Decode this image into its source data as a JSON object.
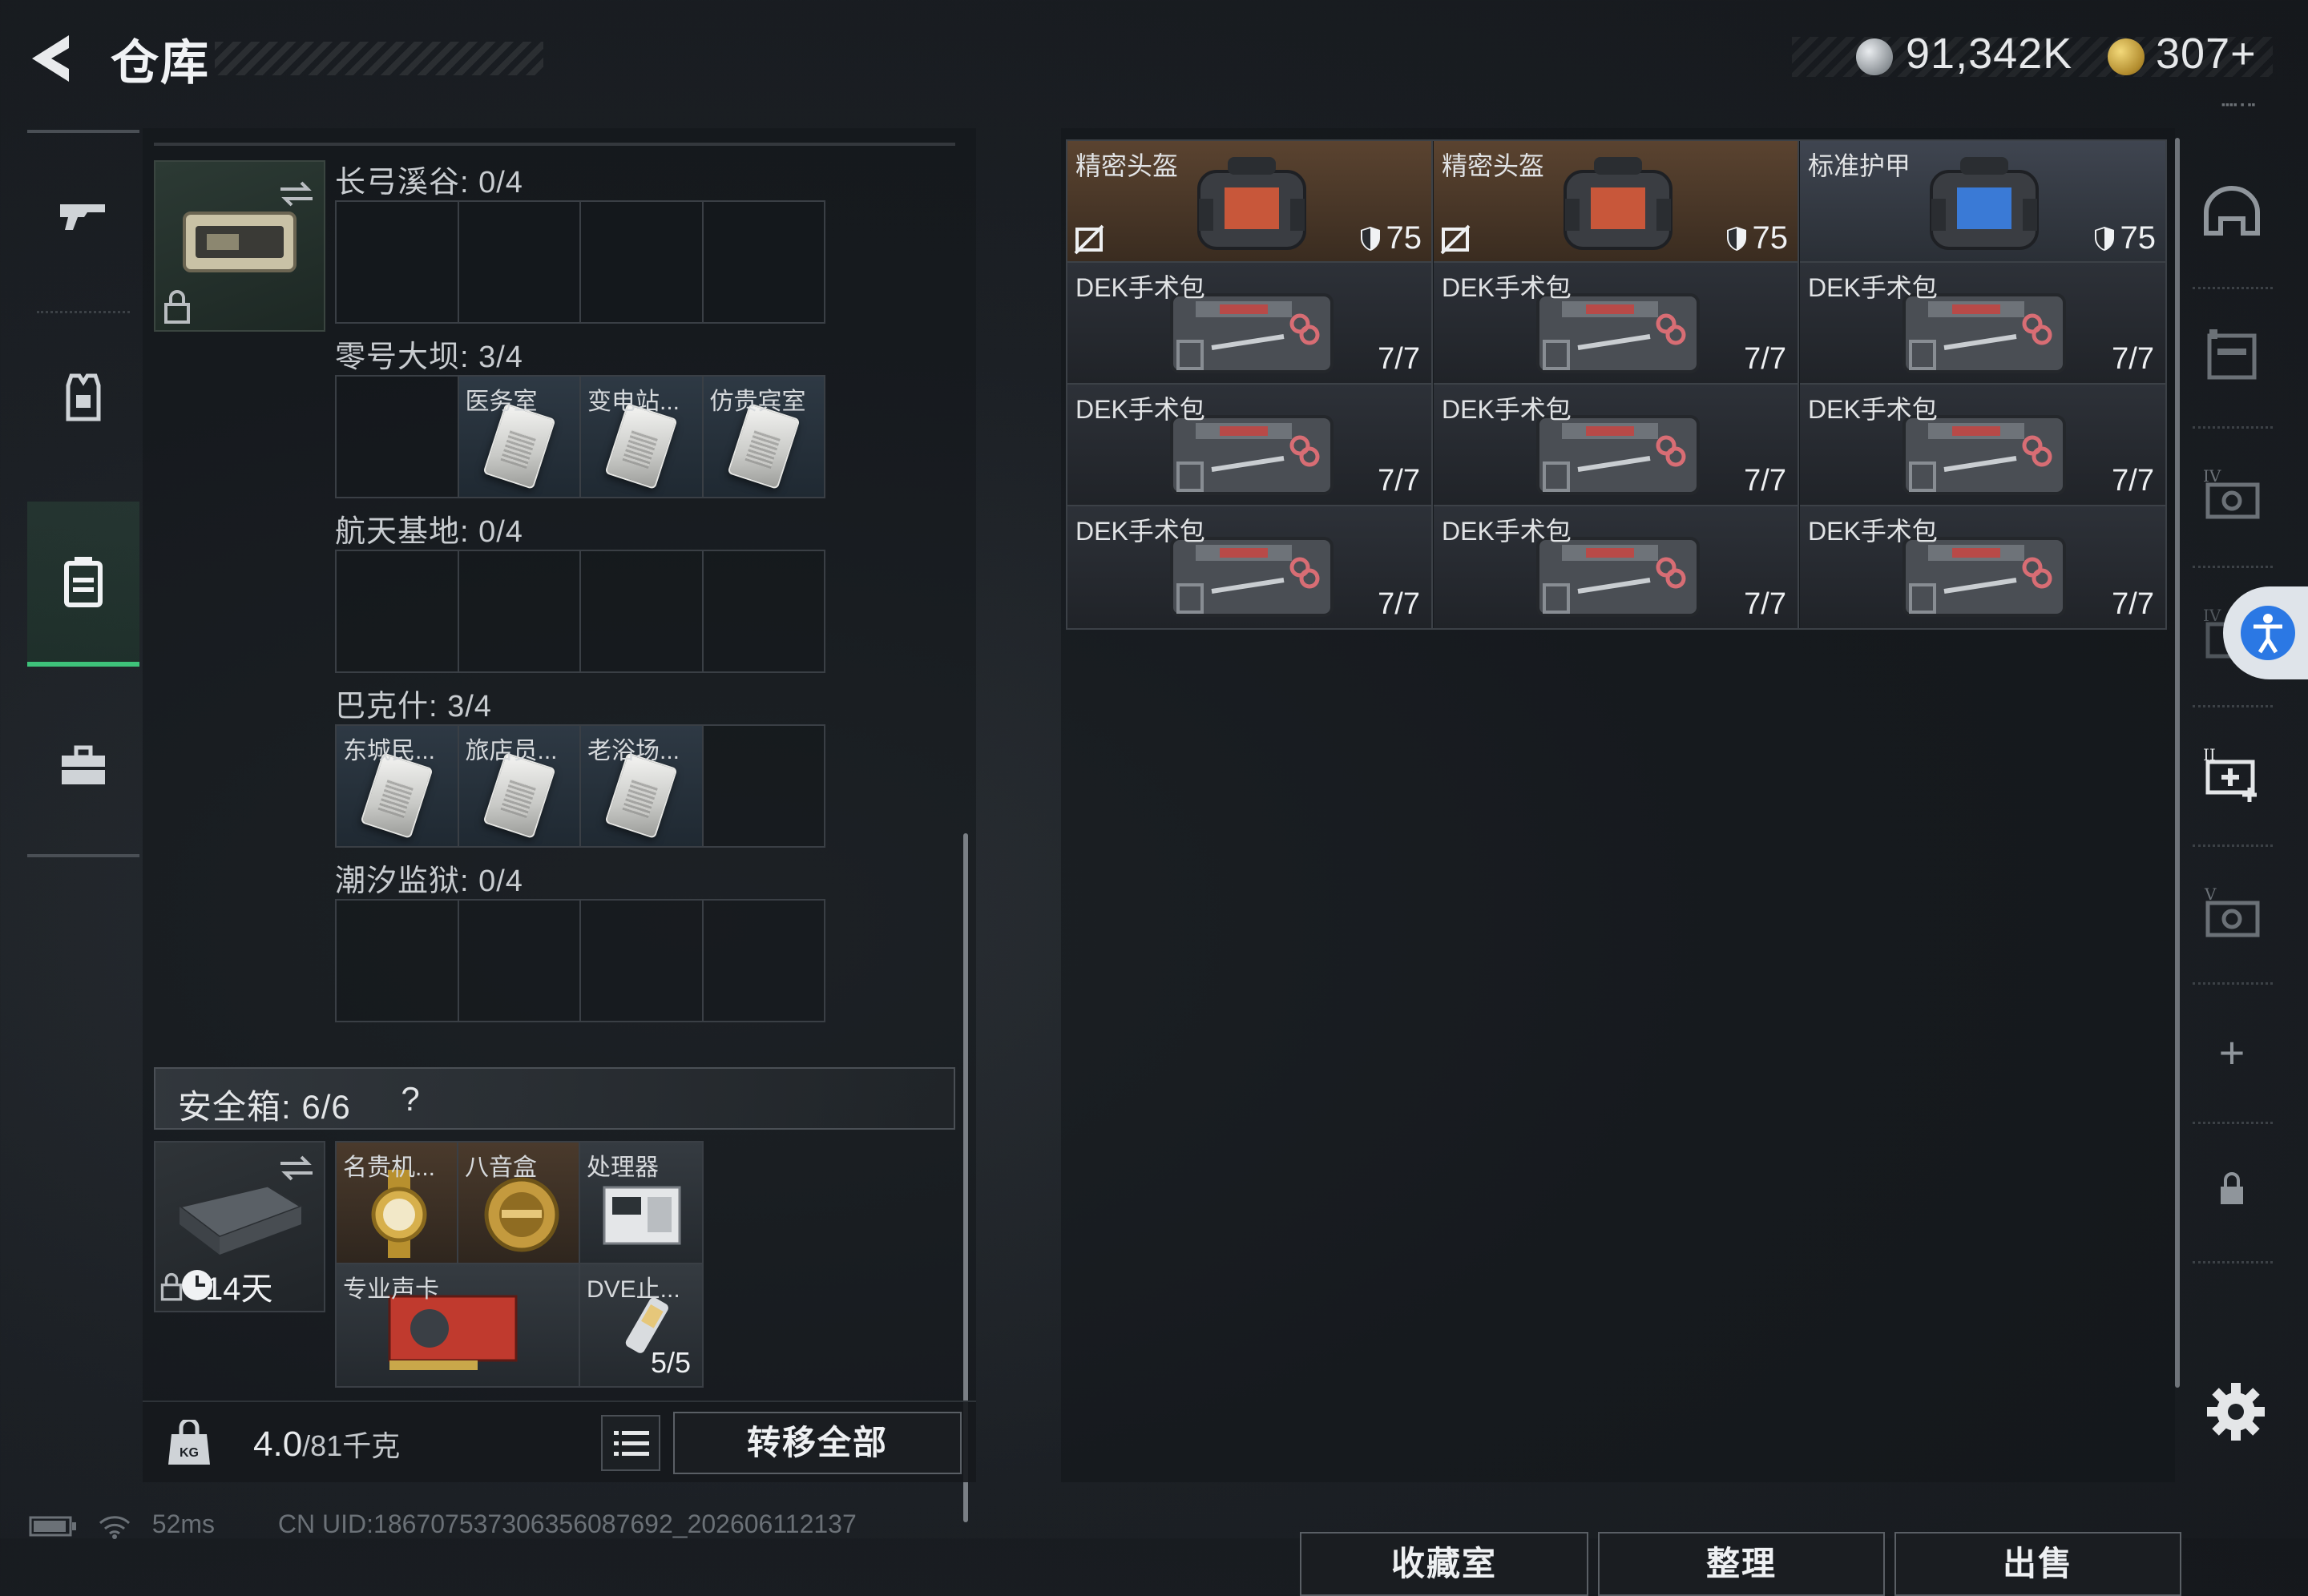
{
  "header": {
    "title": "仓库",
    "silver_amount": "91,342K",
    "gold_amount": "307+",
    "version_mark": "▪▪▪▪ ▪ ▪▪"
  },
  "container": {
    "groups": [
      {
        "label": "长弓溪谷: 0/4",
        "cells": [
          "",
          "",
          "",
          ""
        ]
      },
      {
        "label": "零号大坝: 3/4",
        "cells": [
          "",
          "医务室",
          "变电站...",
          "仿贵宾室"
        ]
      },
      {
        "label": "航天基地: 0/4",
        "cells": [
          "",
          "",
          "",
          ""
        ]
      },
      {
        "label": "巴克什: 3/4",
        "cells": [
          "东城民...",
          "旅店员...",
          "老浴场...",
          ""
        ]
      },
      {
        "label": "潮汐监狱: 0/4",
        "cells": [
          "",
          "",
          "",
          ""
        ]
      }
    ]
  },
  "safe_box": {
    "label": "安全箱: 6/6",
    "help": "?",
    "days": "14天",
    "items": [
      {
        "label": "名贵机..."
      },
      {
        "label": "八音盒"
      },
      {
        "label": "处理器"
      },
      {
        "label": "专业声卡"
      },
      {
        "label": "DVE止...",
        "count": "5/5"
      }
    ]
  },
  "weight": {
    "value": "4.0",
    "max": "/81千克"
  },
  "buttons": {
    "transfer_all": "转移全部",
    "collection": "收藏室",
    "organize": "整理",
    "sell": "出售"
  },
  "stash": {
    "items": [
      {
        "label": "精密头盔",
        "durability": "75",
        "kind": "helmet"
      },
      {
        "label": "精密头盔",
        "durability": "75",
        "kind": "helmet"
      },
      {
        "label": "标准护甲",
        "durability": "75",
        "kind": "armor"
      },
      {
        "label": "DEK手术包",
        "count": "7/7",
        "kind": "kit"
      },
      {
        "label": "DEK手术包",
        "count": "7/7",
        "kind": "kit"
      },
      {
        "label": "DEK手术包",
        "count": "7/7",
        "kind": "kit"
      },
      {
        "label": "DEK手术包",
        "count": "7/7",
        "kind": "kit"
      },
      {
        "label": "DEK手术包",
        "count": "7/7",
        "kind": "kit"
      },
      {
        "label": "DEK手术包",
        "count": "7/7",
        "kind": "kit"
      },
      {
        "label": "DEK手术包",
        "count": "7/7",
        "kind": "kit"
      },
      {
        "label": "DEK手术包",
        "count": "7/7",
        "kind": "kit"
      },
      {
        "label": "DEK手术包",
        "count": "7/7",
        "kind": "kit"
      }
    ]
  },
  "right_nav": {
    "plus": "+"
  },
  "status_bar": {
    "ping": "52ms",
    "uid": "CN UID:18670753730635608769​2_202606112137"
  },
  "colors": {
    "accent_green": "#3ec27a",
    "helmet_bg": "#5a4330",
    "access_blue": "#2b78e4"
  },
  "icons": [
    "back-arrow-icon",
    "silver-coin-icon",
    "gold-coin-icon",
    "gun-icon",
    "vest-icon",
    "backpack-icon",
    "toolbox-icon",
    "helmet-slot-icon",
    "armor-slot-icon",
    "case-slot-icon",
    "add-case-icon",
    "lock-icon",
    "settings-icon",
    "accessibility-icon",
    "battery-icon",
    "wifi-icon"
  ]
}
